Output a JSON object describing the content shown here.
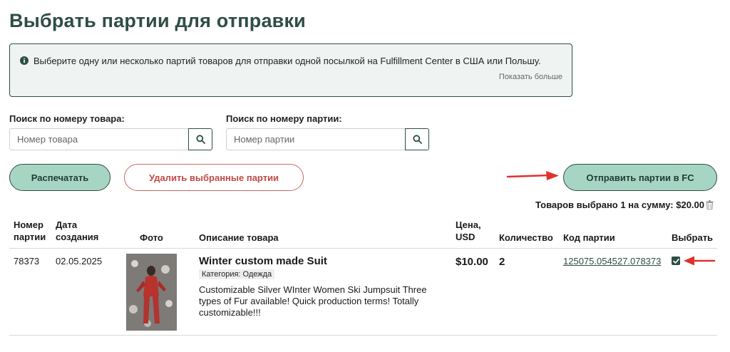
{
  "page": {
    "title": "Выбрать партии для отправки"
  },
  "info": {
    "text": "Выберите одну или несколько партий товаров для отправки одной посылкой на Fulfillment Center в США или Польшу.",
    "more_link": "Показать больше"
  },
  "search": {
    "product": {
      "label": "Поиск по номеру товара:",
      "placeholder": "Номер товара"
    },
    "batch": {
      "label": "Поиск по номеру партии:",
      "placeholder": "Номер партии"
    }
  },
  "actions": {
    "print_label": "Распечатать",
    "delete_label": "Удалить выбранные партии",
    "send_label": "Отправить партии в FC"
  },
  "summary": {
    "text": "Товаров выбрано 1 на сумму: $20.00"
  },
  "table": {
    "headers": {
      "batch_no_1": "Номер",
      "batch_no_2": "партии",
      "date_1": "Дата",
      "date_2": "создания",
      "photo": "Фото",
      "description": "Описание товара",
      "price_1": "Цена,",
      "price_2": "USD",
      "quantity": "Количество",
      "code": "Код партии",
      "select": "Выбрать"
    },
    "rows": [
      {
        "batch_no": "78373",
        "date": "02.05.2025",
        "title": "Winter custom made Suit",
        "category": "Категория: Одежда",
        "description": "Customizable Silver WInter Women Ski Jumpsuit Three types of Fur available! Quick production terms! Totally customizable!!!",
        "price": "$10.00",
        "quantity": "2",
        "code": "125075.054527.078373",
        "selected": true
      }
    ]
  },
  "colors": {
    "accent": "#2f4d47",
    "button_fill": "#a7d5c4",
    "danger": "#c24a44",
    "arrow": "#e0322b"
  }
}
